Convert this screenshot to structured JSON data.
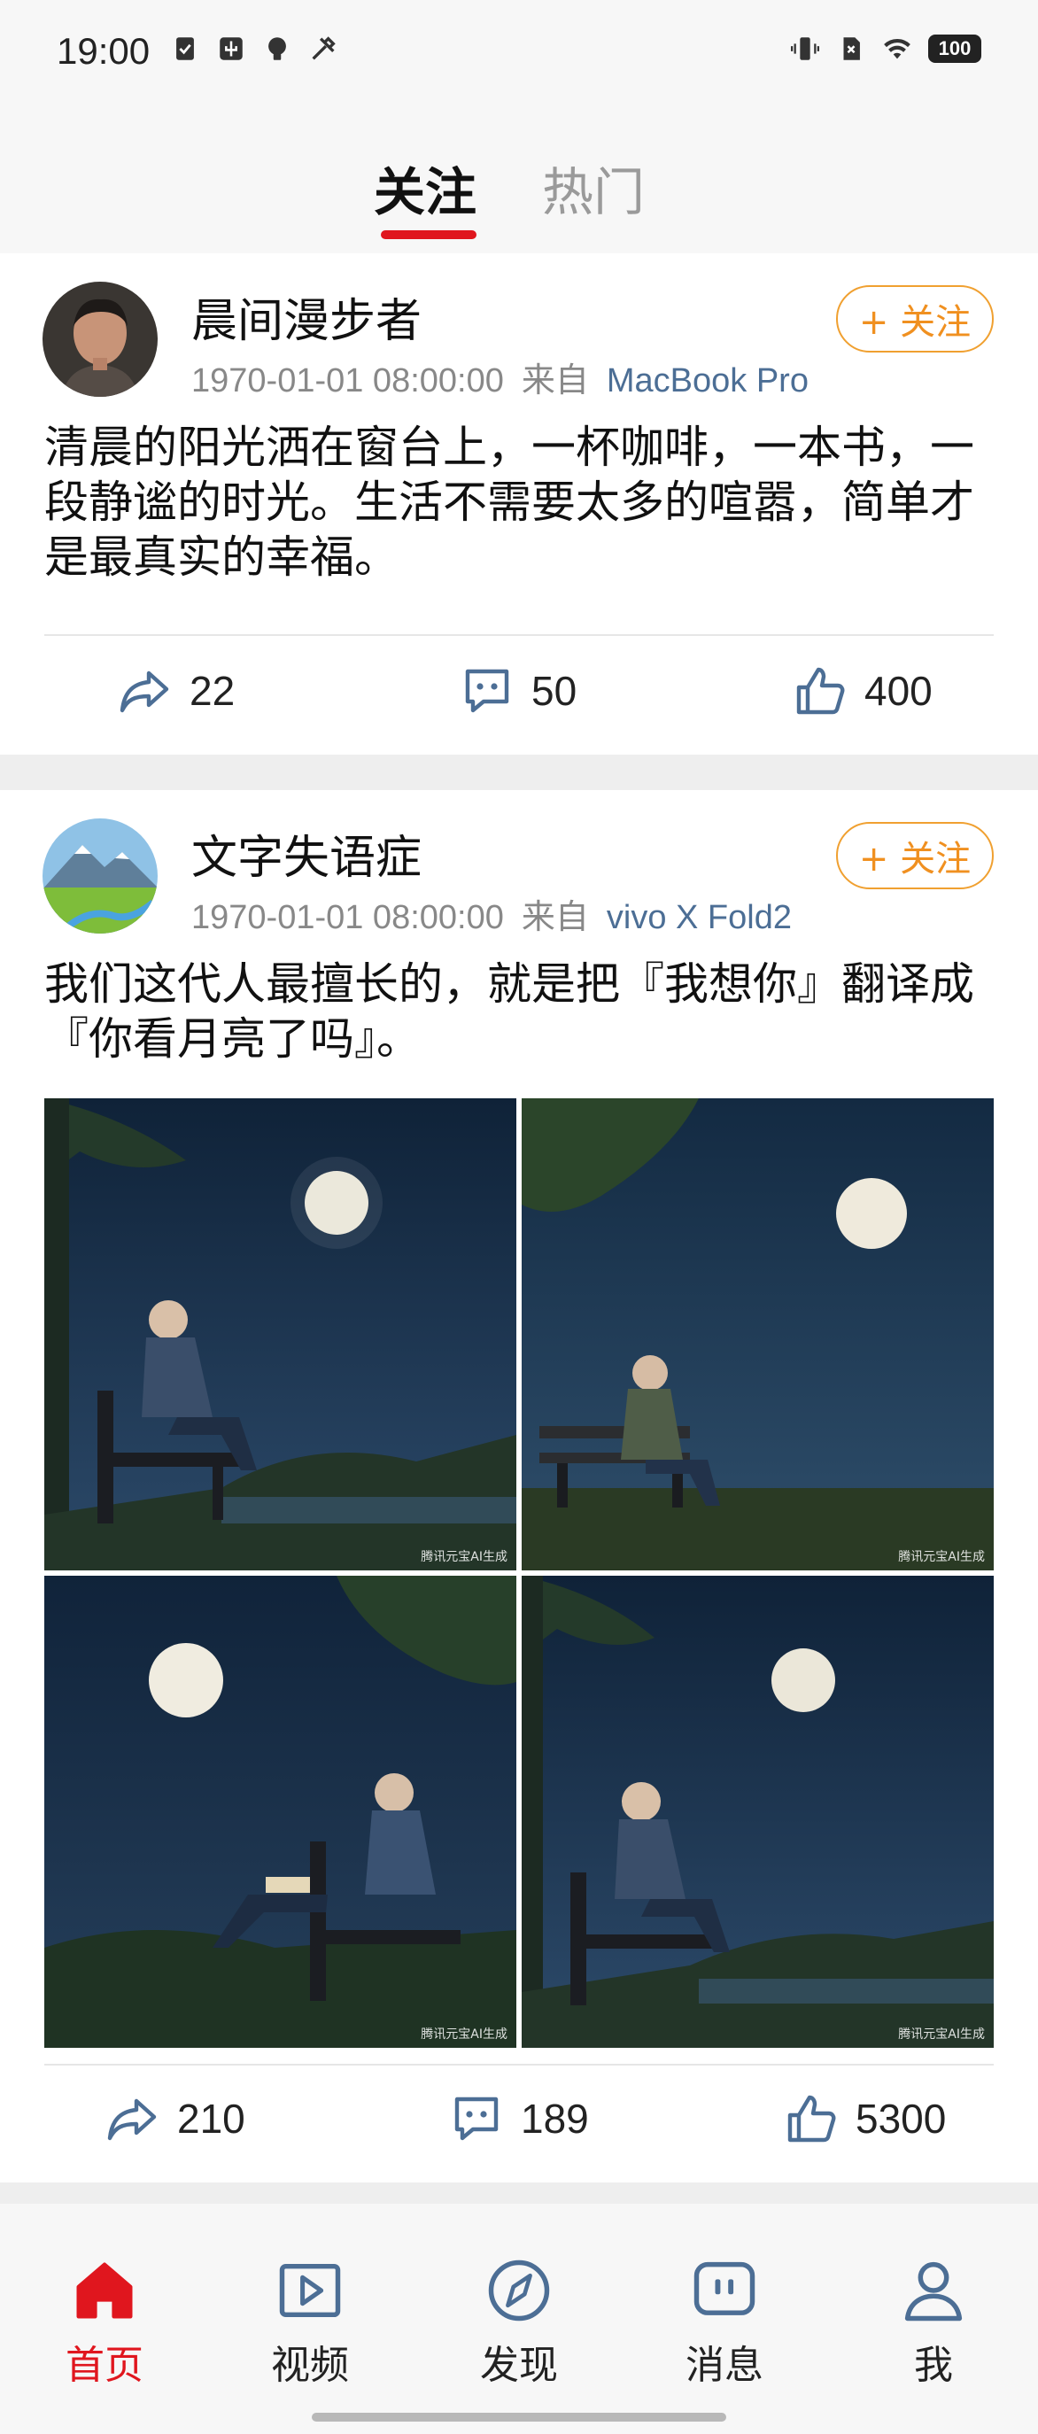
{
  "status_bar": {
    "time": "19:00",
    "left_icons": [
      "clipboard-check-icon",
      "usb-debug-icon",
      "lightbulb-icon",
      "tools-icon"
    ],
    "right_icons": [
      "vibrate-icon",
      "no-sim-icon",
      "wifi-icon"
    ],
    "battery": "100"
  },
  "tabs": [
    {
      "label": "关注",
      "active": true
    },
    {
      "label": "热门",
      "active": false
    }
  ],
  "accent_color": "#e0161e",
  "follow_color": "#f09020",
  "posts": [
    {
      "author": "晨间漫步者",
      "timestamp": "1970-01-01 08:00:00",
      "from_label": "来自",
      "device": "MacBook Pro",
      "follow_label": "+ 关注",
      "text": "清晨的阳光洒在窗台上，一杯咖啡，一本书，一段静谧的时光。生活不需要太多的喧嚣，简单才是最真实的幸福。",
      "reposts": "22",
      "comments": "50",
      "likes": "400"
    },
    {
      "author": "文字失语症",
      "timestamp": "1970-01-01 08:00:00",
      "from_label": "来自",
      "device": "vivo X Fold2",
      "follow_label": "+ 关注",
      "text": "我们这代人最擅长的，就是把『我想你』翻译成『你看月亮了吗』。",
      "images": [
        {
          "watermark": "腾讯元宝AI生成"
        },
        {
          "watermark": "腾讯元宝AI生成"
        },
        {
          "watermark": "腾讯元宝AI生成"
        },
        {
          "watermark": "腾讯元宝AI生成"
        }
      ],
      "reposts": "210",
      "comments": "189",
      "likes": "5300"
    }
  ],
  "bottom_nav": [
    {
      "label": "首页",
      "icon": "home-icon",
      "active": true
    },
    {
      "label": "视频",
      "icon": "video-icon",
      "active": false
    },
    {
      "label": "发现",
      "icon": "compass-icon",
      "active": false
    },
    {
      "label": "消息",
      "icon": "message-icon",
      "active": false
    },
    {
      "label": "我",
      "icon": "profile-icon",
      "active": false
    }
  ]
}
